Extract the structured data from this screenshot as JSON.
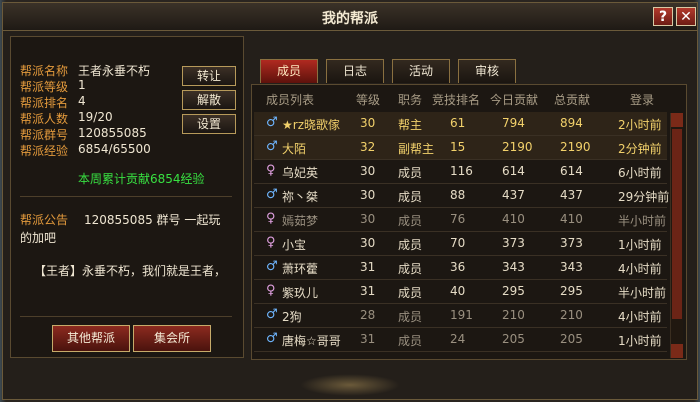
{
  "window": {
    "title": "我的帮派",
    "help": "?",
    "close": "✕"
  },
  "guild": {
    "info": [
      {
        "label": "帮派名称",
        "value": "王者永垂不朽"
      },
      {
        "label": "帮派等级",
        "value": "1"
      },
      {
        "label": "帮派排名",
        "value": "4"
      },
      {
        "label": "帮派人数",
        "value": "19/20"
      },
      {
        "label": "帮派群号",
        "value": "120855085"
      },
      {
        "label": "帮派经验",
        "value": "6854/65500"
      }
    ],
    "weekly": "本周累计贡献6854经验",
    "buttons": {
      "transfer": "转让",
      "disband": "解散",
      "settings": "设置"
    },
    "notice_label": "帮派公告",
    "notice_text": "120855085 群号 一起玩的加吧",
    "notice_msg": "【王者】永垂不朽，我们就是王者，",
    "bottom": {
      "other": "其他帮派",
      "market": "集会所"
    }
  },
  "tabs": [
    "成员",
    "日志",
    "活动",
    "审核"
  ],
  "columns": [
    "成员列表",
    "等级",
    "职务",
    "竞技排名",
    "今日贡献",
    "总贡献",
    "登录"
  ],
  "members": [
    {
      "gender": "♂",
      "name": "★rz晓歌傢",
      "level": "30",
      "role": "帮主",
      "rank": "61",
      "today": "794",
      "total": "894",
      "login": "2小时前",
      "hl": true
    },
    {
      "gender": "♂",
      "name": "大陌",
      "level": "32",
      "role": "副帮主",
      "rank": "15",
      "today": "2190",
      "total": "2190",
      "login": "2分钟前",
      "hl": true
    },
    {
      "gender": "♀",
      "name": "乌妃英",
      "level": "30",
      "role": "成员",
      "rank": "116",
      "today": "614",
      "total": "614",
      "login": "6小时前",
      "hl": false
    },
    {
      "gender": "♂",
      "name": "祢丶桀",
      "level": "30",
      "role": "成员",
      "rank": "88",
      "today": "437",
      "total": "437",
      "login": "29分钟前",
      "hl": false
    },
    {
      "gender": "♀",
      "name": "嫣茹梦",
      "level": "30",
      "role": "成员",
      "rank": "76",
      "today": "410",
      "total": "410",
      "login": "半小时前",
      "hl": false
    },
    {
      "gender": "♀",
      "name": "小宝",
      "level": "30",
      "role": "成员",
      "rank": "70",
      "today": "373",
      "total": "373",
      "login": "1小时前",
      "hl": false
    },
    {
      "gender": "♂",
      "name": "萧环藿",
      "level": "31",
      "role": "成员",
      "rank": "36",
      "today": "343",
      "total": "343",
      "login": "4小时前",
      "hl": false
    },
    {
      "gender": "♀",
      "name": "紫玖儿",
      "level": "31",
      "role": "成员",
      "rank": "40",
      "today": "295",
      "total": "295",
      "login": "半小时前",
      "hl": false
    },
    {
      "gender": "♂",
      "name": "2狗",
      "level": "28",
      "role": "成员",
      "rank": "191",
      "today": "210",
      "total": "210",
      "login": "4小时前",
      "hl": false
    },
    {
      "gender": "♂",
      "name": "唐梅☆哥哥",
      "level": "31",
      "role": "成员",
      "rank": "24",
      "today": "205",
      "total": "205",
      "login": "1小时前",
      "hl": false
    }
  ],
  "colors": {
    "accent": "#e39a3c",
    "green": "#38e041",
    "leader": "#f2d16b",
    "gray": "#9a9080"
  }
}
